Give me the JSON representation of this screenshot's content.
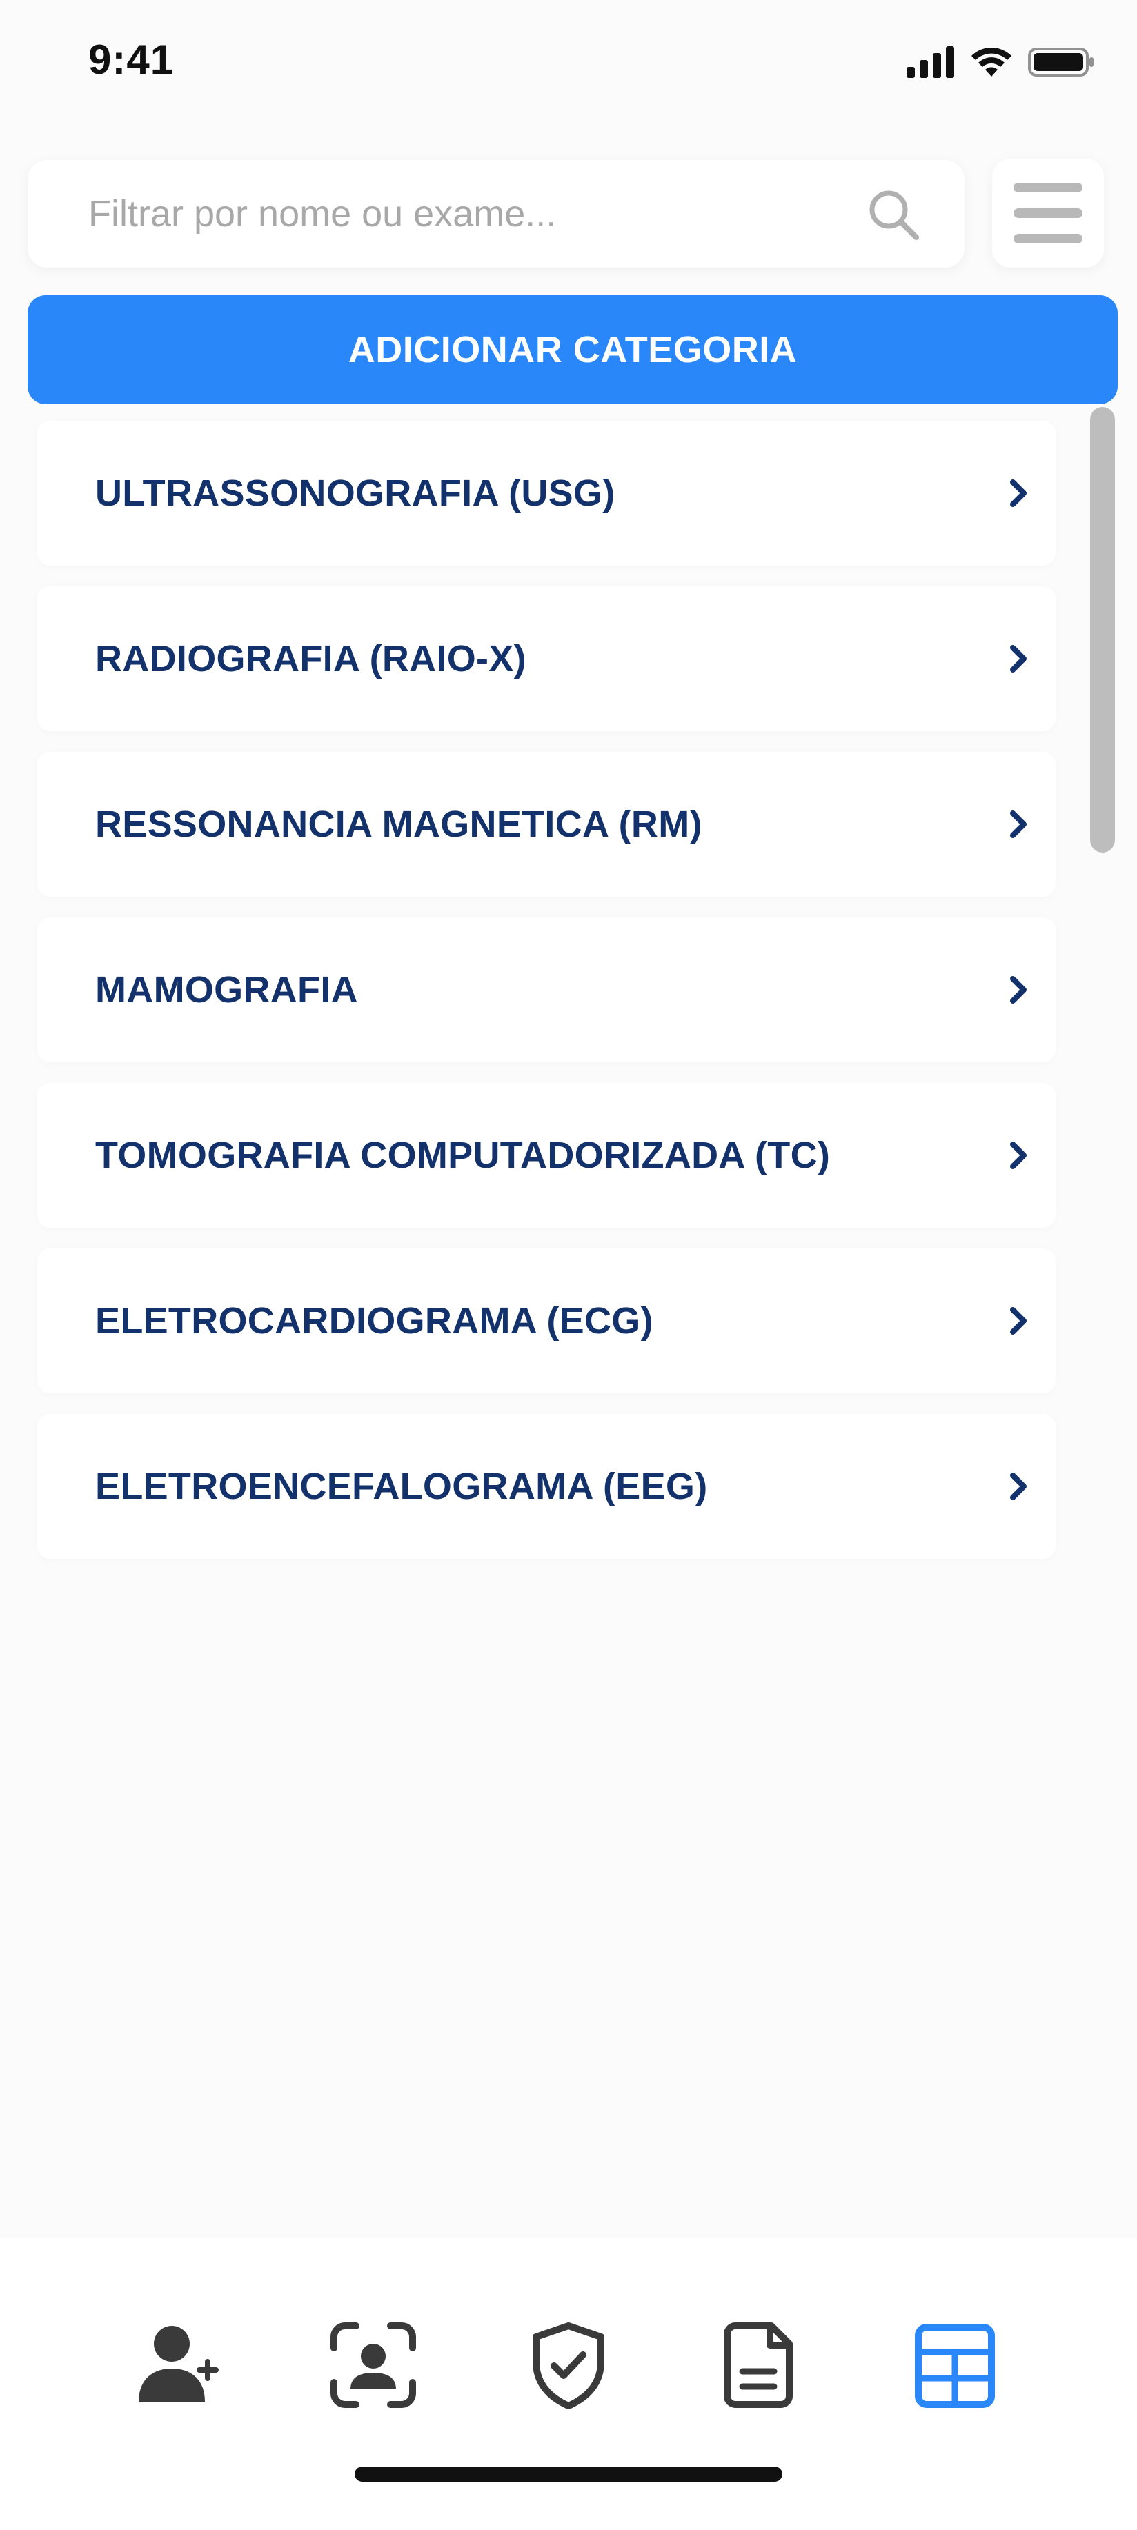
{
  "status_bar": {
    "time": "9:41",
    "icons": [
      "cellular-signal-icon",
      "wifi-icon",
      "battery-icon"
    ]
  },
  "search": {
    "placeholder": "Filtrar por nome ou exame...",
    "value": "",
    "icon": "search-icon"
  },
  "menu_button": {
    "icon": "hamburger-menu-icon"
  },
  "add_category": {
    "label": "ADICIONAR CATEGORIA"
  },
  "categories": [
    {
      "label": "ULTRASSONOGRAFIA (USG)"
    },
    {
      "label": "RADIOGRAFIA (RAIO-X)"
    },
    {
      "label": "RESSONANCIA MAGNETICA (RM)"
    },
    {
      "label": "MAMOGRAFIA"
    },
    {
      "label": "TOMOGRAFIA COMPUTADORIZADA (TC)"
    },
    {
      "label": "ELETROCARDIOGRAMA (ECG)"
    },
    {
      "label": "ELETROENCEFALOGRAMA (EEG)"
    }
  ],
  "bottom_nav": [
    {
      "icon": "add-user-icon",
      "active": false
    },
    {
      "icon": "face-scan-icon",
      "active": false
    },
    {
      "icon": "shield-check-icon",
      "active": false
    },
    {
      "icon": "document-icon",
      "active": false
    },
    {
      "icon": "grid-table-icon",
      "active": true
    }
  ],
  "colors": {
    "primary": "#2a87fa",
    "list_text": "#13316b",
    "nav_icon": "#3a3a3a",
    "nav_active": "#2a87fa",
    "background": "#fbfbfb",
    "placeholder": "#a8a8a8"
  }
}
